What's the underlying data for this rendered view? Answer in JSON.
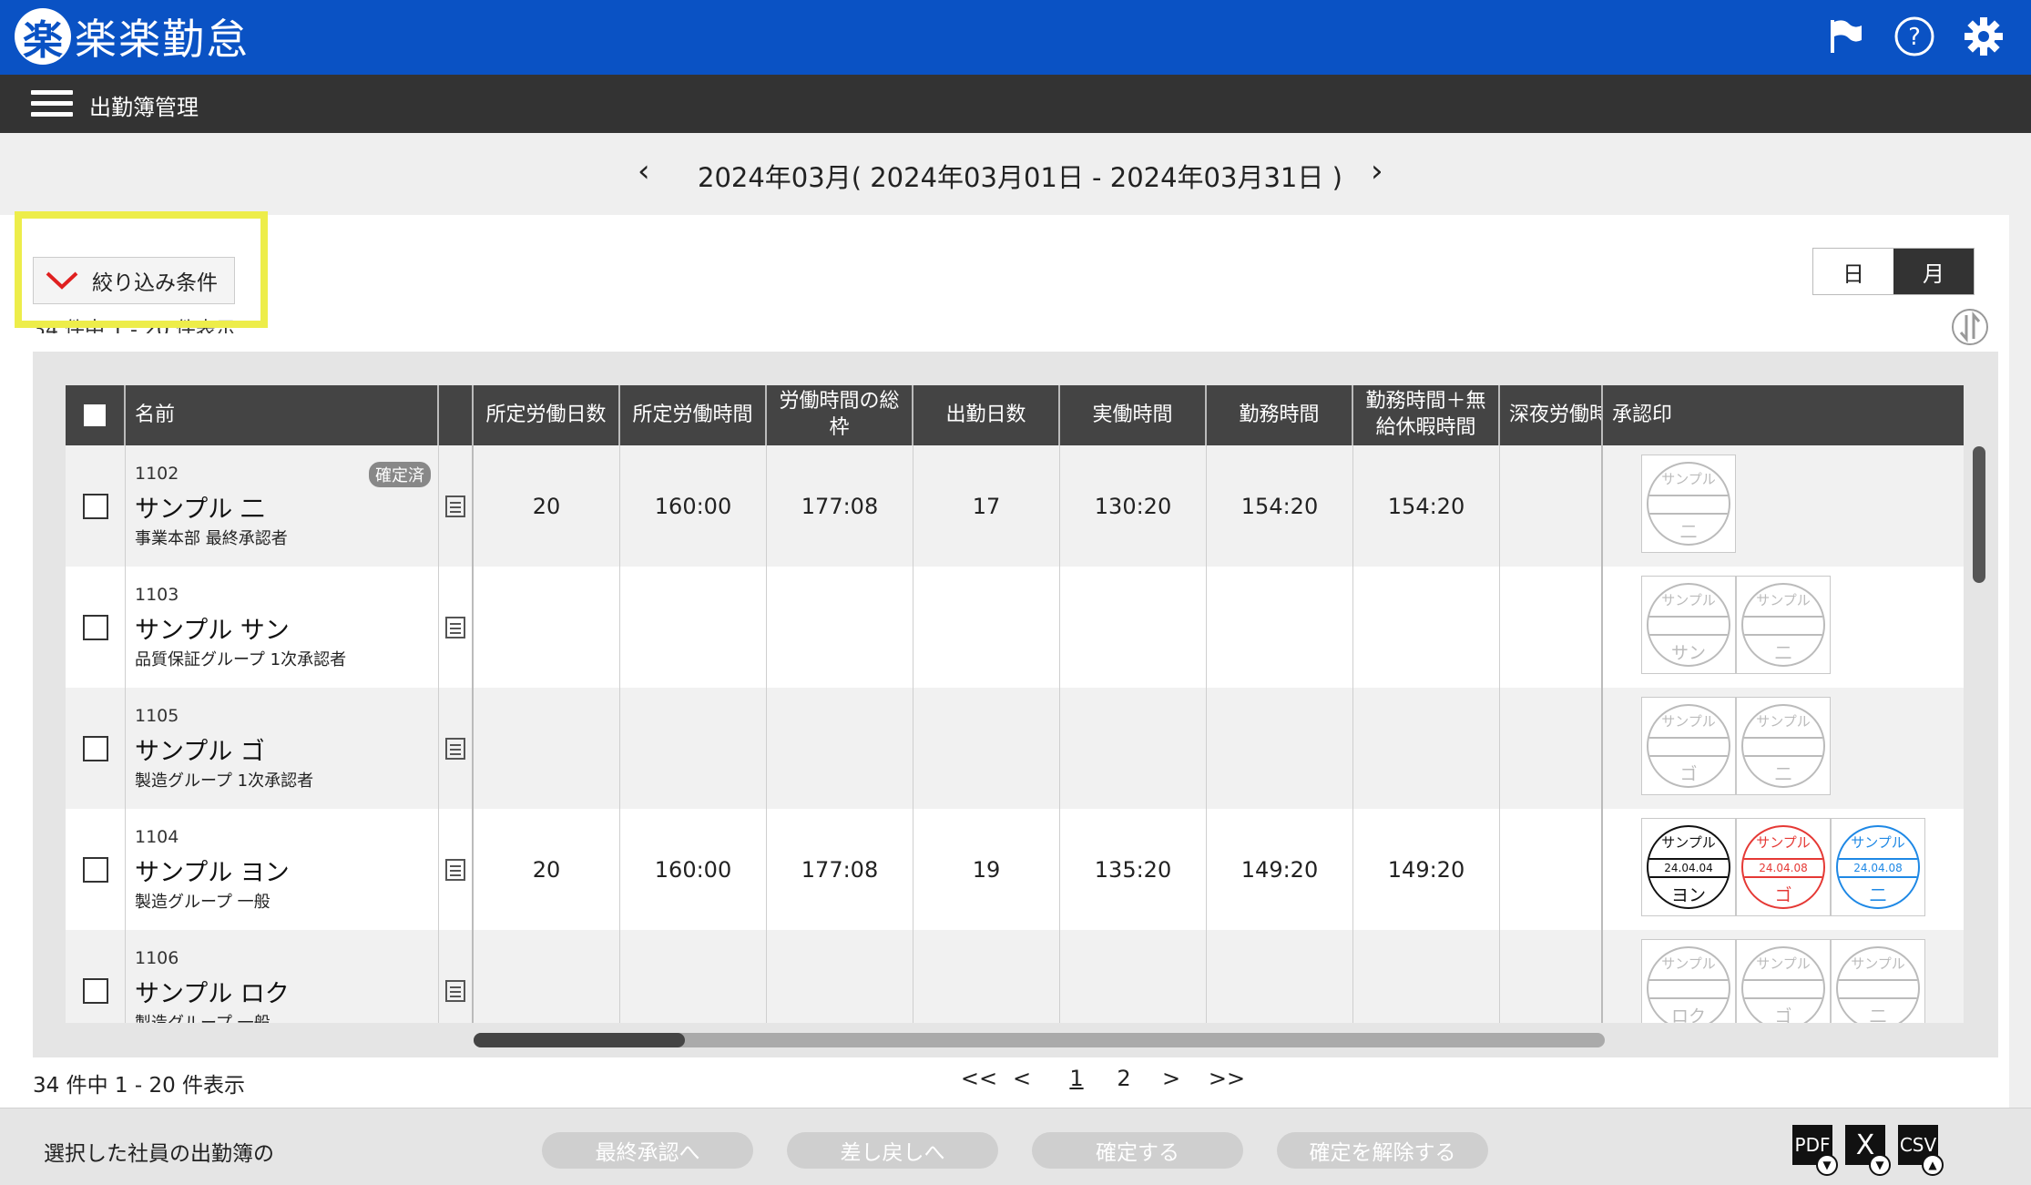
{
  "app": {
    "logo_mark": "楽",
    "title": "楽楽勤怠"
  },
  "header": {
    "icons": [
      "flag-icon",
      "help-icon",
      "gear-icon"
    ]
  },
  "subbar": {
    "title": "出勤簿管理"
  },
  "period": {
    "label": "2024年03月( 2024年03月01日 - 2024年03月31日 )",
    "prev": "‹",
    "next": "›"
  },
  "filter": {
    "label": "絞り込み条件"
  },
  "view_toggle": {
    "day": "日",
    "month": "月"
  },
  "count_text": "34 件中 1 - 20 件表示",
  "table": {
    "columns": [
      "名前",
      "所定労働日数",
      "所定労働時間",
      "労働時間の総\n枠",
      "出勤日数",
      "実働時間",
      "勤務時間",
      "勤務時間＋無\n給休暇時間",
      "深夜労働時",
      "承認印"
    ],
    "rows": [
      {
        "emp_no": "1102",
        "name": "サンプル 二",
        "dept": "事業本部 最終承認者",
        "badge": "確定済",
        "values": [
          "20",
          "160:00",
          "177:08",
          "17",
          "130:20",
          "154:20",
          "154:20",
          ""
        ],
        "stamps": [
          {
            "top": "サンプル",
            "date": "",
            "bottom": "二",
            "color": "#bbbbbb"
          }
        ]
      },
      {
        "emp_no": "1103",
        "name": "サンプル サン",
        "dept": "品質保証グループ 1次承認者",
        "badge": "",
        "values": [
          "",
          "",
          "",
          "",
          "",
          "",
          "",
          ""
        ],
        "stamps": [
          {
            "top": "サンプル",
            "date": "",
            "bottom": "サン",
            "color": "#bbbbbb"
          },
          {
            "top": "サンプル",
            "date": "",
            "bottom": "二",
            "color": "#bbbbbb"
          }
        ]
      },
      {
        "emp_no": "1105",
        "name": "サンプル ゴ",
        "dept": "製造グループ 1次承認者",
        "badge": "",
        "values": [
          "",
          "",
          "",
          "",
          "",
          "",
          "",
          ""
        ],
        "stamps": [
          {
            "top": "サンプル",
            "date": "",
            "bottom": "ゴ",
            "color": "#bbbbbb"
          },
          {
            "top": "サンプル",
            "date": "",
            "bottom": "二",
            "color": "#bbbbbb"
          }
        ]
      },
      {
        "emp_no": "1104",
        "name": "サンプル ヨン",
        "dept": "製造グループ 一般",
        "badge": "",
        "values": [
          "20",
          "160:00",
          "177:08",
          "19",
          "135:20",
          "149:20",
          "149:20",
          ""
        ],
        "stamps": [
          {
            "top": "サンプル",
            "date": "24.04.04",
            "bottom": "ヨン",
            "color": "#111111"
          },
          {
            "top": "サンプル",
            "date": "24.04.08",
            "bottom": "ゴ",
            "color": "#e53935"
          },
          {
            "top": "サンプル",
            "date": "24.04.08",
            "bottom": "二",
            "color": "#1e88e5"
          }
        ]
      },
      {
        "emp_no": "1106",
        "name": "サンプル ロク",
        "dept": "製造グループ 一般",
        "badge": "",
        "values": [
          "",
          "",
          "",
          "",
          "",
          "",
          "",
          ""
        ],
        "stamps": [
          {
            "top": "サンプル",
            "date": "",
            "bottom": "ロク",
            "color": "#bbbbbb"
          },
          {
            "top": "サンプル",
            "date": "",
            "bottom": "ゴ",
            "color": "#bbbbbb"
          },
          {
            "top": "サンプル",
            "date": "",
            "bottom": "二",
            "color": "#bbbbbb"
          }
        ]
      }
    ]
  },
  "pagination": {
    "first": "<<",
    "prev": "<",
    "pages": [
      "1",
      "2"
    ],
    "current": "1",
    "next": ">",
    "last": ">>"
  },
  "footer": {
    "label": "選択した社員の出勤簿の",
    "buttons": [
      "最終承認へ",
      "差し戻しへ",
      "確定する",
      "確定を解除する"
    ],
    "exports": [
      {
        "label": "PDF",
        "arrow": "▼"
      },
      {
        "label": "X",
        "arrow": "▼"
      },
      {
        "label": "CSV",
        "arrow": "▲"
      }
    ]
  },
  "colors": {
    "brand": "#0a52c4",
    "highlight": "#eded4a",
    "header_bg": "#444444"
  }
}
